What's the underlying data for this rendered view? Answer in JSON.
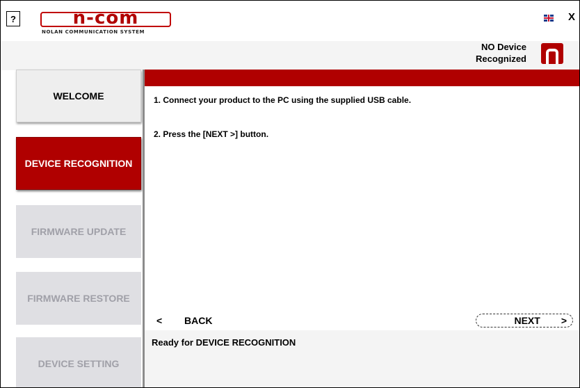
{
  "header": {
    "help_label": "?",
    "logo_text": "n-com",
    "logo_subtitle": "NOLAN COMMUNICATION SYSTEM",
    "language_icon": "uk-flag-icon",
    "close_label": "X"
  },
  "device_status": {
    "line1": "NO Device",
    "line2": "Recognized",
    "icon": "n-com-device-icon"
  },
  "sidebar": {
    "items": [
      {
        "label": "WELCOME",
        "state": "enabled"
      },
      {
        "label": "DEVICE RECOGNITION",
        "state": "active"
      },
      {
        "label": "FIRMWARE UPDATE",
        "state": "disabled"
      },
      {
        "label": "FIRMWARE RESTORE",
        "state": "disabled"
      },
      {
        "label": "DEVICE SETTING",
        "state": "disabled"
      }
    ]
  },
  "main": {
    "instructions": [
      "1. Connect your product to the PC using the supplied USB cable.",
      "2. Press the [NEXT >] button."
    ],
    "back_arrow": "<",
    "back_label": "BACK",
    "next_label": "NEXT",
    "next_arrow": ">"
  },
  "status_bar": {
    "message": "Ready for DEVICE RECOGNITION"
  },
  "colors": {
    "accent": "#b00000",
    "disabled_bg": "#dfdfe3",
    "disabled_text": "#a0a0a8"
  }
}
